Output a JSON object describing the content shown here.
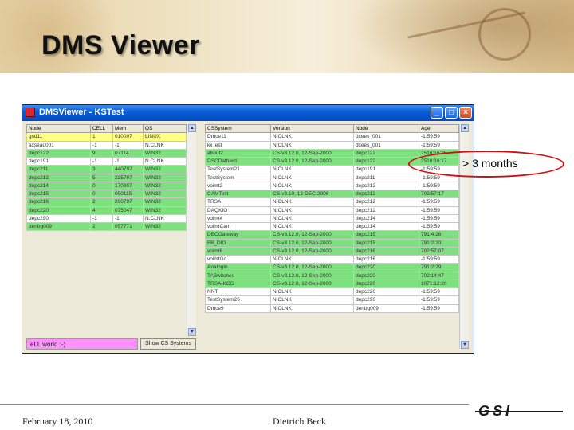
{
  "slide": {
    "title": "DMS Viewer",
    "footer_date": "February 18, 2010",
    "footer_author": "Dietrich Beck",
    "logo_text": "GSI",
    "annotation": "> 3 months",
    "colors": {
      "annotation_ring": "#d01010",
      "green_row": "#7fe07f",
      "selected_row": "#ffff80",
      "status_bg": "#ff90ff"
    }
  },
  "window": {
    "title": "DMSViewer - KSTest",
    "icons": [
      "app-icon",
      "minimize-icon",
      "maximize-icon",
      "close-icon"
    ],
    "status_text": "eLL world :-)",
    "show_button": "Show CS Systems"
  },
  "nodes_table": {
    "headers": [
      "Node",
      "CELL",
      "Mem",
      "OS"
    ],
    "rows": [
      {
        "cells": [
          "gsd11",
          "1",
          "010007",
          "LINUX"
        ],
        "style": "sel"
      },
      {
        "cells": [
          "axseau001",
          "-1",
          "-1",
          "N.CLNK"
        ],
        "style": ""
      },
      {
        "cells": [
          "depc122",
          "9",
          "07114",
          "WIN32"
        ],
        "style": "green"
      },
      {
        "cells": [
          "depc191",
          "-1",
          "-1",
          "N.CLNK"
        ],
        "style": ""
      },
      {
        "cells": [
          "depc211",
          "3",
          "440797",
          "WIN32"
        ],
        "style": "green"
      },
      {
        "cells": [
          "depc212",
          "5",
          "225797",
          "WIN32"
        ],
        "style": "green"
      },
      {
        "cells": [
          "depc214",
          "0",
          "170907",
          "WIN32"
        ],
        "style": "green"
      },
      {
        "cells": [
          "depc215",
          "0",
          "050115",
          "WIN32"
        ],
        "style": "green"
      },
      {
        "cells": [
          "depc216",
          "2",
          "200797",
          "WIN32"
        ],
        "style": "green"
      },
      {
        "cells": [
          "depc220",
          "4",
          "075047",
          "WIN32"
        ],
        "style": "green"
      },
      {
        "cells": [
          "depc290",
          "-1",
          "-1",
          "N.CLNK"
        ],
        "style": ""
      },
      {
        "cells": [
          "denbg009",
          "2",
          "057771",
          "WIN32"
        ],
        "style": "green"
      }
    ]
  },
  "systems_table": {
    "headers": [
      "CSSystem",
      "Version",
      "Node",
      "Age"
    ],
    "rows": [
      {
        "cells": [
          "Dmce11",
          "N.CLNK",
          "dxees_001",
          "-1:59:59"
        ],
        "style": ""
      },
      {
        "cells": [
          "kxTest",
          "N.CLNK",
          "dxees_001",
          "-1:59:59"
        ],
        "style": ""
      },
      {
        "cells": [
          "about2",
          "CS-v3.12.0, 12-Sep-2000",
          "depc122",
          "2516:16:25"
        ],
        "style": "green"
      },
      {
        "cells": [
          "DSCDatherd",
          "CS-v3.12.0, 12-Sep-2000",
          "depc122",
          "2516:16:17"
        ],
        "style": "green"
      },
      {
        "cells": [
          "TestSystem21",
          "N.CLNK",
          "depc191",
          "-1:59:59"
        ],
        "style": ""
      },
      {
        "cells": [
          "TestSystem",
          "N.CLNK",
          "depc211",
          "-1:59:59"
        ],
        "style": ""
      },
      {
        "cells": [
          "voimt2",
          "N.CLNK",
          "depc212",
          "-1:59:59"
        ],
        "style": ""
      },
      {
        "cells": [
          "CAMTest",
          "CS-v3.10, 12-DEC-2006",
          "depc212",
          "702:57:17"
        ],
        "style": "green"
      },
      {
        "cells": [
          "TRSA",
          "N.CLNK",
          "depc212",
          "-1:59:59"
        ],
        "style": ""
      },
      {
        "cells": [
          "DAQKIO",
          "N.CLNK",
          "depc212",
          "-1:59:59"
        ],
        "style": ""
      },
      {
        "cells": [
          "voimt4",
          "N.CLNK",
          "depc214",
          "-1:59:59"
        ],
        "style": ""
      },
      {
        "cells": [
          "voimtCam",
          "N.CLNK",
          "depc214",
          "-1:59:59"
        ],
        "style": ""
      },
      {
        "cells": [
          "DECGateway",
          "CS-v3.12.0, 12-Sep-2000",
          "depc215",
          "791:4:26"
        ],
        "style": "green"
      },
      {
        "cells": [
          "FB_DIO",
          "CS-v3.12.0, 12-Sep-2000",
          "depc215",
          "791:2:20"
        ],
        "style": "green"
      },
      {
        "cells": [
          "voimt6",
          "CS-v3.12.0, 12-Sep-2000",
          "depc216",
          "702:57:07"
        ],
        "style": "green"
      },
      {
        "cells": [
          "voimtGc",
          "N.CLNK",
          "depc216",
          "-1:59:59"
        ],
        "style": ""
      },
      {
        "cells": [
          "AnalogIn",
          "CS-v3.12.0, 12-Sep-2000",
          "depc220",
          "791:2:29"
        ],
        "style": "green"
      },
      {
        "cells": [
          "TASwitches",
          "CS-v3.12.0, 12-Sep-2000",
          "depc220",
          "702:14:47"
        ],
        "style": "green"
      },
      {
        "cells": [
          "TRSA-KCG",
          "CS-v3.12.0, 12-Sep-2000",
          "depc220",
          "1071:12:20"
        ],
        "style": "green"
      },
      {
        "cells": [
          "NNT",
          "N.CLNK",
          "depc220",
          "-1:59:59"
        ],
        "style": ""
      },
      {
        "cells": [
          "TestSystem26",
          "N.CLNK",
          "depc290",
          "-1:59:59"
        ],
        "style": ""
      },
      {
        "cells": [
          "Dmce9",
          "N.CLNK",
          "denbg009",
          "-1:59:59"
        ],
        "style": ""
      }
    ]
  }
}
